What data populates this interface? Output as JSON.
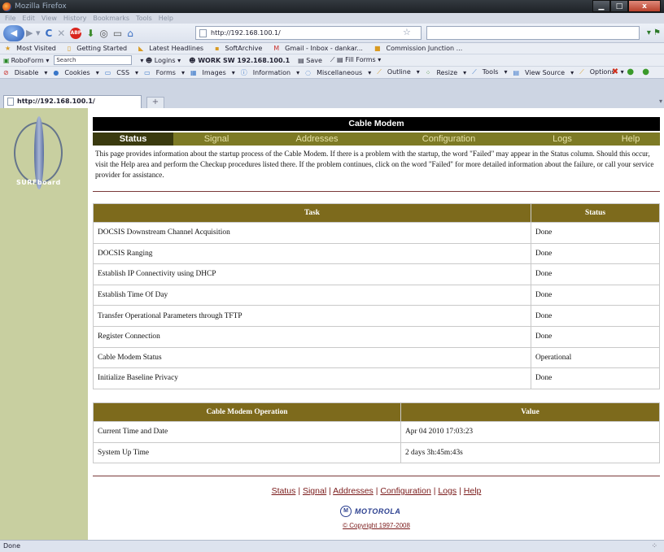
{
  "browser": {
    "window_title": "Mozilla Firefox",
    "menu": [
      "File",
      "Edit",
      "View",
      "History",
      "Bookmarks",
      "Tools",
      "Help"
    ],
    "url": "http://192.168.100.1/",
    "tab_title": "http://192.168.100.1/",
    "new_tab_symbol": "+",
    "status": "Done"
  },
  "bookmarks": [
    "Most Visited",
    "Getting Started",
    "Latest Headlines",
    "SoftArchive",
    "Gmail - Inbox - dankar...",
    "Commission Junction ..."
  ],
  "roboform": {
    "label": "RoboForm",
    "search_label": "Search",
    "items": [
      "Logins",
      "WORK SW 192.168.100.1",
      "Save",
      "Fill Forms"
    ]
  },
  "webdev_toolbar": [
    "Disable",
    "Cookies",
    "CSS",
    "Forms",
    "Images",
    "Information",
    "Miscellaneous",
    "Outline",
    "Resize",
    "Tools",
    "View Source",
    "Options"
  ],
  "page": {
    "logo_text": "SURFboard",
    "header_title": "Cable Modem",
    "nav": [
      {
        "label": "Status",
        "active": true
      },
      {
        "label": "Signal",
        "active": false
      },
      {
        "label": "Addresses",
        "active": false
      },
      {
        "label": "Configuration",
        "active": false
      },
      {
        "label": "Logs",
        "active": false
      },
      {
        "label": "Help",
        "active": false
      }
    ],
    "intro": "This page provides information about the startup process of the Cable Modem. If there is a problem with the startup, the word \"Failed\" may appear in the Status column. Should this occur, visit the Help area and perform the Checkup procedures listed there. If the problem continues, click on the word \"Failed\" for more detailed information about the failure, or call your service provider for assistance.",
    "task_table": {
      "headers": [
        "Task",
        "Status"
      ],
      "rows": [
        [
          "DOCSIS Downstream Channel Acquisition",
          "Done"
        ],
        [
          "DOCSIS Ranging",
          "Done"
        ],
        [
          "Establish IP Connectivity using DHCP",
          "Done"
        ],
        [
          "Establish Time Of Day",
          "Done"
        ],
        [
          "Transfer Operational Parameters through TFTP",
          "Done"
        ],
        [
          "Register Connection",
          "Done"
        ],
        [
          "Cable Modem Status",
          "Operational"
        ],
        [
          "Initialize Baseline Privacy",
          "Done"
        ]
      ]
    },
    "operation_table": {
      "headers": [
        "Cable Modem Operation",
        "Value"
      ],
      "rows": [
        [
          "Current Time and Date",
          "Apr 04 2010 17:03:23"
        ],
        [
          "System Up Time",
          "2 days 3h:45m:43s"
        ]
      ]
    },
    "footer_links": [
      "Status",
      "Signal",
      "Addresses",
      "Configuration",
      "Logs",
      "Help"
    ],
    "footer_separator": "|",
    "brand": "MOTOROLA",
    "brand_emblem": "M",
    "copyright": "© Copyright 1997-2008"
  },
  "colors": {
    "nav_bg": "#7d7a25",
    "nav_active": "#3a3a0f",
    "table_header": "#7d6a1c",
    "sidebar": "#c8cfa0",
    "link": "#7a1a1a"
  }
}
